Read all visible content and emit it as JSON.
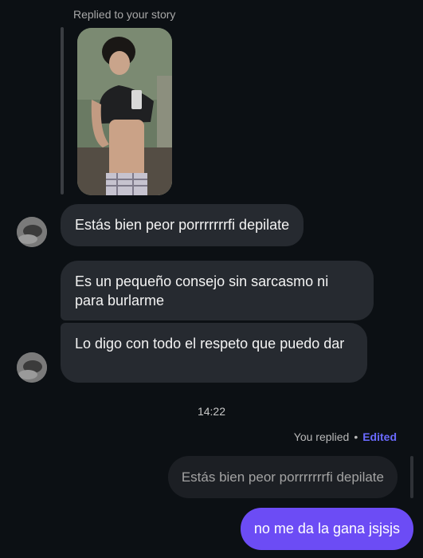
{
  "story": {
    "caption": "Replied to your story",
    "thumbnail_icon": "story-photo"
  },
  "messages_incoming": [
    {
      "text": "Estás bien peor porrrrrrrfi depilate"
    },
    {
      "text": "Es un pequeño consejo sin sarcasmo ni para burlarme"
    },
    {
      "text": "Lo digo con todo el respeto que puedo dar"
    }
  ],
  "timestamp": "14:22",
  "reply": {
    "label": "You replied",
    "separator": "•",
    "edited_label": "Edited",
    "quoted_text": "Estás bien peor porrrrrrrfi depilate",
    "text": "no me da la gana jsjsjs"
  },
  "colors": {
    "background": "#0c1014",
    "incoming_bubble": "#262a30",
    "outgoing_bubble": "#6c4cf5",
    "edited": "#6a6aff"
  }
}
